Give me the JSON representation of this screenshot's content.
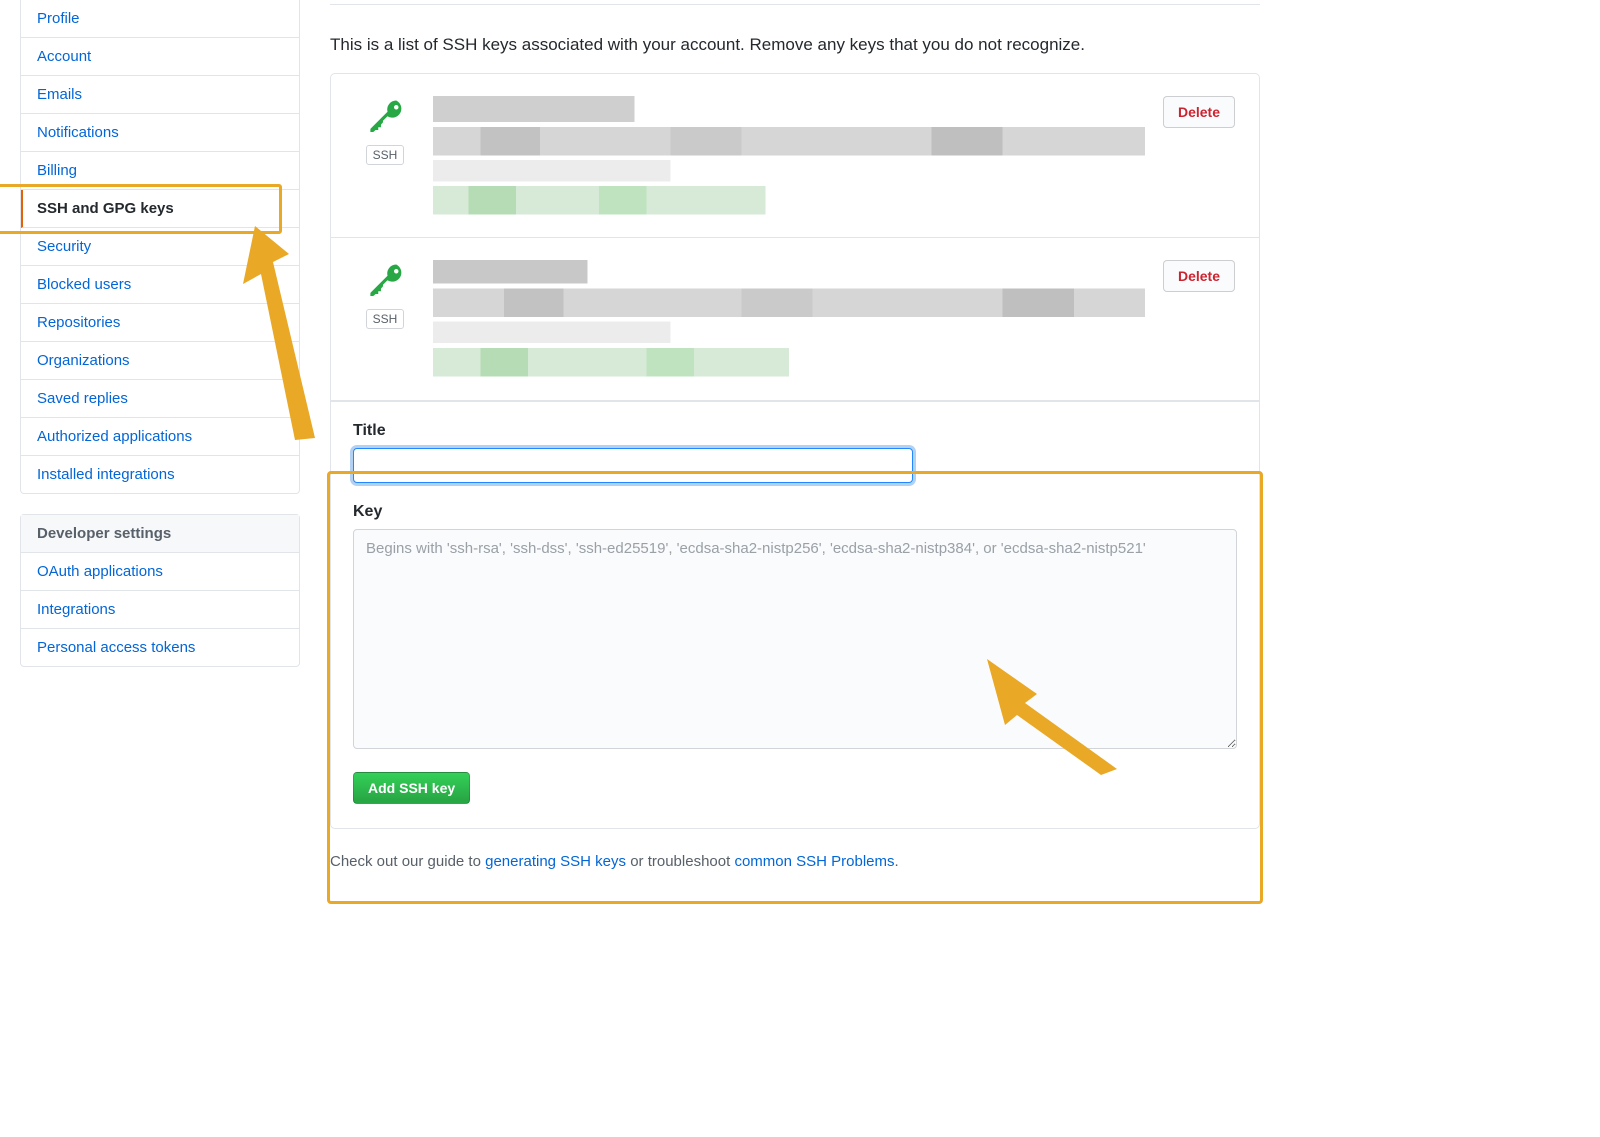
{
  "sidebar": {
    "personal_items": [
      {
        "label": "Profile",
        "selected": false
      },
      {
        "label": "Account",
        "selected": false
      },
      {
        "label": "Emails",
        "selected": false
      },
      {
        "label": "Notifications",
        "selected": false
      },
      {
        "label": "Billing",
        "selected": false
      },
      {
        "label": "SSH and GPG keys",
        "selected": true
      },
      {
        "label": "Security",
        "selected": false
      },
      {
        "label": "Blocked users",
        "selected": false
      },
      {
        "label": "Repositories",
        "selected": false
      },
      {
        "label": "Organizations",
        "selected": false
      },
      {
        "label": "Saved replies",
        "selected": false
      },
      {
        "label": "Authorized applications",
        "selected": false
      },
      {
        "label": "Installed integrations",
        "selected": false
      }
    ],
    "dev_header": "Developer settings",
    "dev_items": [
      {
        "label": "OAuth applications"
      },
      {
        "label": "Integrations"
      },
      {
        "label": "Personal access tokens"
      }
    ]
  },
  "main": {
    "intro": "This is a list of SSH keys associated with your account. Remove any keys that you do not recognize.",
    "ssh_badge": "SSH",
    "delete_label": "Delete",
    "form": {
      "title_label": "Title",
      "title_value": "",
      "key_label": "Key",
      "key_placeholder": "Begins with 'ssh-rsa', 'ssh-dss', 'ssh-ed25519', 'ecdsa-sha2-nistp256', 'ecdsa-sha2-nistp384', or 'ecdsa-sha2-nistp521'",
      "key_value": "",
      "submit_label": "Add SSH key"
    },
    "footer": {
      "prefix": "Check out our guide to ",
      "link1": "generating SSH keys",
      "middle": " or troubleshoot ",
      "link2": "common SSH Problems",
      "suffix": "."
    }
  },
  "colors": {
    "accent": "#0366d6",
    "highlight": "#e9a826",
    "danger": "#cb2431",
    "primary": "#2ea44f"
  }
}
